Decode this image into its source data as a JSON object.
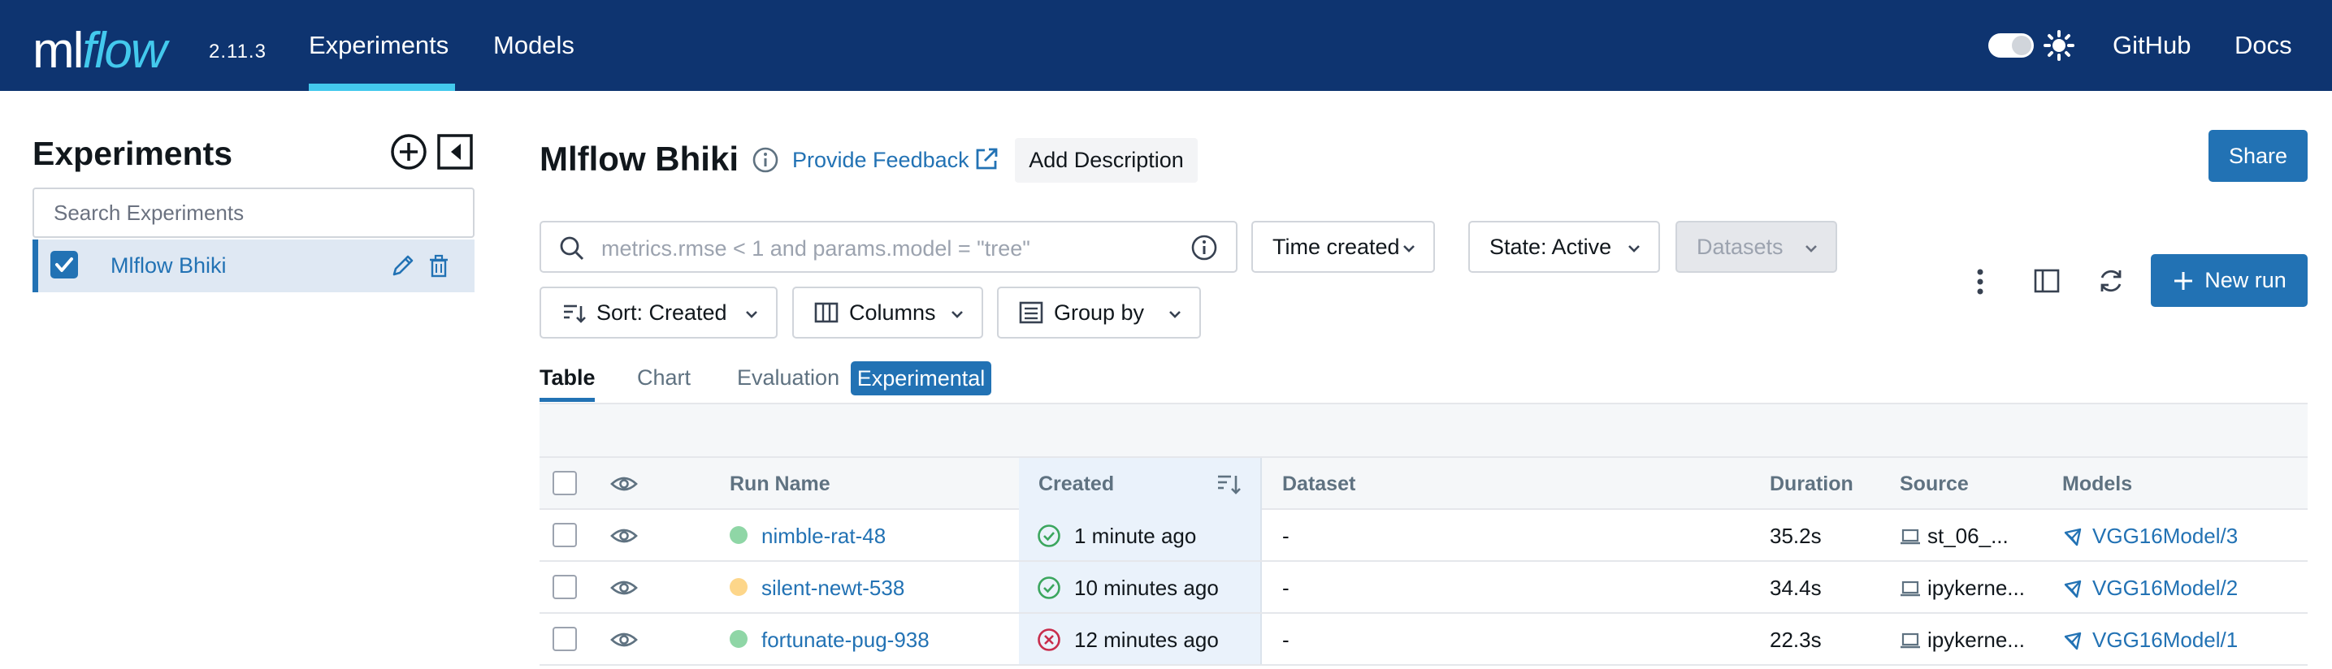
{
  "app": {
    "logo_ml": "ml",
    "logo_flow": "flow",
    "version": "2.11.3",
    "nav": [
      "Experiments",
      "Models"
    ],
    "links": [
      "GitHub",
      "Docs"
    ],
    "colors": {
      "topbar": "#0e3470",
      "accent": "#43c9ed",
      "primary": "#2272b4"
    }
  },
  "sidebar": {
    "title": "Experiments",
    "search_placeholder": "Search Experiments",
    "items": [
      {
        "label": "Mlflow Bhiki",
        "checked": true
      }
    ]
  },
  "header": {
    "title": "Mlflow Bhiki",
    "feedback": "Provide Feedback",
    "add_description": "Add Description",
    "share": "Share"
  },
  "filters": {
    "search_placeholder": "metrics.rmse < 1 and params.model = \"tree\"",
    "time_created": "Time created",
    "state": "State: Active",
    "datasets": "Datasets",
    "sort": "Sort: Created",
    "columns": "Columns",
    "group_by": "Group by",
    "new_run": "New run"
  },
  "tabs": {
    "items": [
      "Table",
      "Chart",
      "Evaluation"
    ],
    "active": "Table",
    "badge": "Experimental"
  },
  "table": {
    "columns": [
      "Run Name",
      "Created",
      "Dataset",
      "Duration",
      "Source",
      "Models"
    ],
    "rows": [
      {
        "dot_color": "#8fd6a6",
        "name": "nimble-rat-48",
        "status": "success",
        "created": "1 minute ago",
        "dataset": "-",
        "duration": "35.2s",
        "source": "st_06_...",
        "model": "VGG16Model/3"
      },
      {
        "dot_color": "#fdd68a",
        "name": "silent-newt-538",
        "status": "success",
        "created": "10 minutes ago",
        "dataset": "-",
        "duration": "34.4s",
        "source": "ipykerne...",
        "model": "VGG16Model/2"
      },
      {
        "dot_color": "#8fd6a6",
        "name": "fortunate-pug-938",
        "status": "failed",
        "created": "12 minutes ago",
        "dataset": "-",
        "duration": "22.3s",
        "source": "ipykerne...",
        "model": "VGG16Model/1"
      }
    ]
  }
}
